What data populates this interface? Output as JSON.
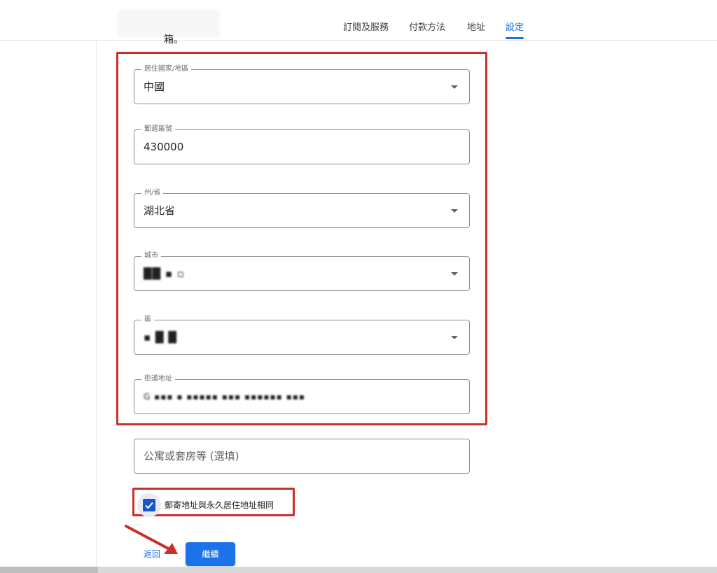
{
  "nav": {
    "tabs": [
      {
        "label": "訂閱及服務"
      },
      {
        "label": "付款方法"
      },
      {
        "label": "地址"
      },
      {
        "label": "設定",
        "active": true
      }
    ]
  },
  "overflow_text": "箱。",
  "form": {
    "country": {
      "label": "居住國家/地區",
      "value": "中國"
    },
    "postal": {
      "label": "郵遞區號",
      "value": "430000"
    },
    "province": {
      "label": "州/省",
      "value": "湖北省"
    },
    "city": {
      "label": "城市",
      "value": "██ ▪ ▫"
    },
    "district": {
      "label": "區",
      "value": "▪ █ █"
    },
    "street": {
      "label": "街道地址",
      "value": "G ▪▪▪ ▪ ▪▪▪▪▪ ▪▪▪ ▪▪▪▪▪▪ ▪▪▪"
    },
    "apartment": {
      "placeholder": "公寓或套房等 (選填)"
    },
    "same_address": {
      "label": "郵寄地址與永久居住地址相同",
      "checked": true
    }
  },
  "actions": {
    "back_label": "返回",
    "continue_label": "繼續"
  },
  "colors": {
    "accent": "#1a73e8",
    "highlight": "#c9302c",
    "checkbox": "#1a56c8"
  }
}
